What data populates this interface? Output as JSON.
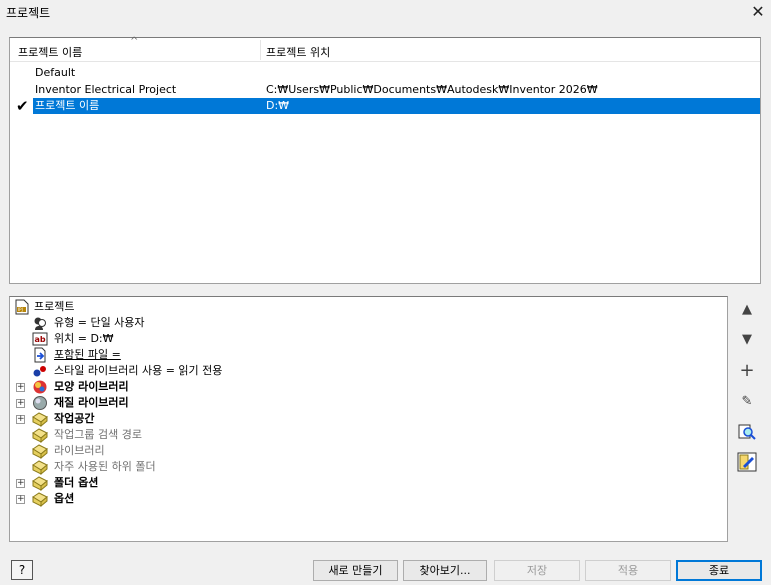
{
  "window": {
    "title": "프로젝트",
    "close_glyph": "✕"
  },
  "project_list": {
    "columns": {
      "name": "프로젝트 이름",
      "location": "프로젝트 위치"
    },
    "sort_glyph": "^",
    "rows": [
      {
        "name": "Default",
        "location": "",
        "active": false,
        "selected": false
      },
      {
        "name": "Inventor Electrical Project",
        "location": "C:₩Users₩Public₩Documents₩Autodesk₩Inventor 2026₩",
        "active": false,
        "selected": false
      },
      {
        "name": "프로젝트 이름",
        "location": "D:₩",
        "active": true,
        "selected": true
      }
    ],
    "check_glyph": "✔",
    "selection_color": "#0078d7"
  },
  "tree": {
    "root": "프로젝트",
    "items": {
      "type": "유형 = 단일 사용자",
      "location": "위치 = D:₩",
      "included_file": "포함된 파일 =",
      "style_library": "스타일 라이브러리 사용 = 읽기 전용",
      "appearance_library": "모양 라이브러리",
      "material_library": "재질 라이브러리",
      "workspace": "작업공간",
      "workgroup_search": "작업그룹 검색 경로",
      "libraries": "라이브러리",
      "frequent_subfolders": "자주 사용된 하위 폴더",
      "folder_options": "폴더 옵션",
      "options": "옵션"
    },
    "expander_glyph": "+"
  },
  "side_buttons": {
    "up": "▲",
    "down": "▼",
    "add": "+",
    "edit": "✎"
  },
  "buttons": {
    "help": "?",
    "new": "새로 만들기",
    "browse": "찾아보기...",
    "save": "저장",
    "apply": "적용",
    "close": "종료"
  }
}
